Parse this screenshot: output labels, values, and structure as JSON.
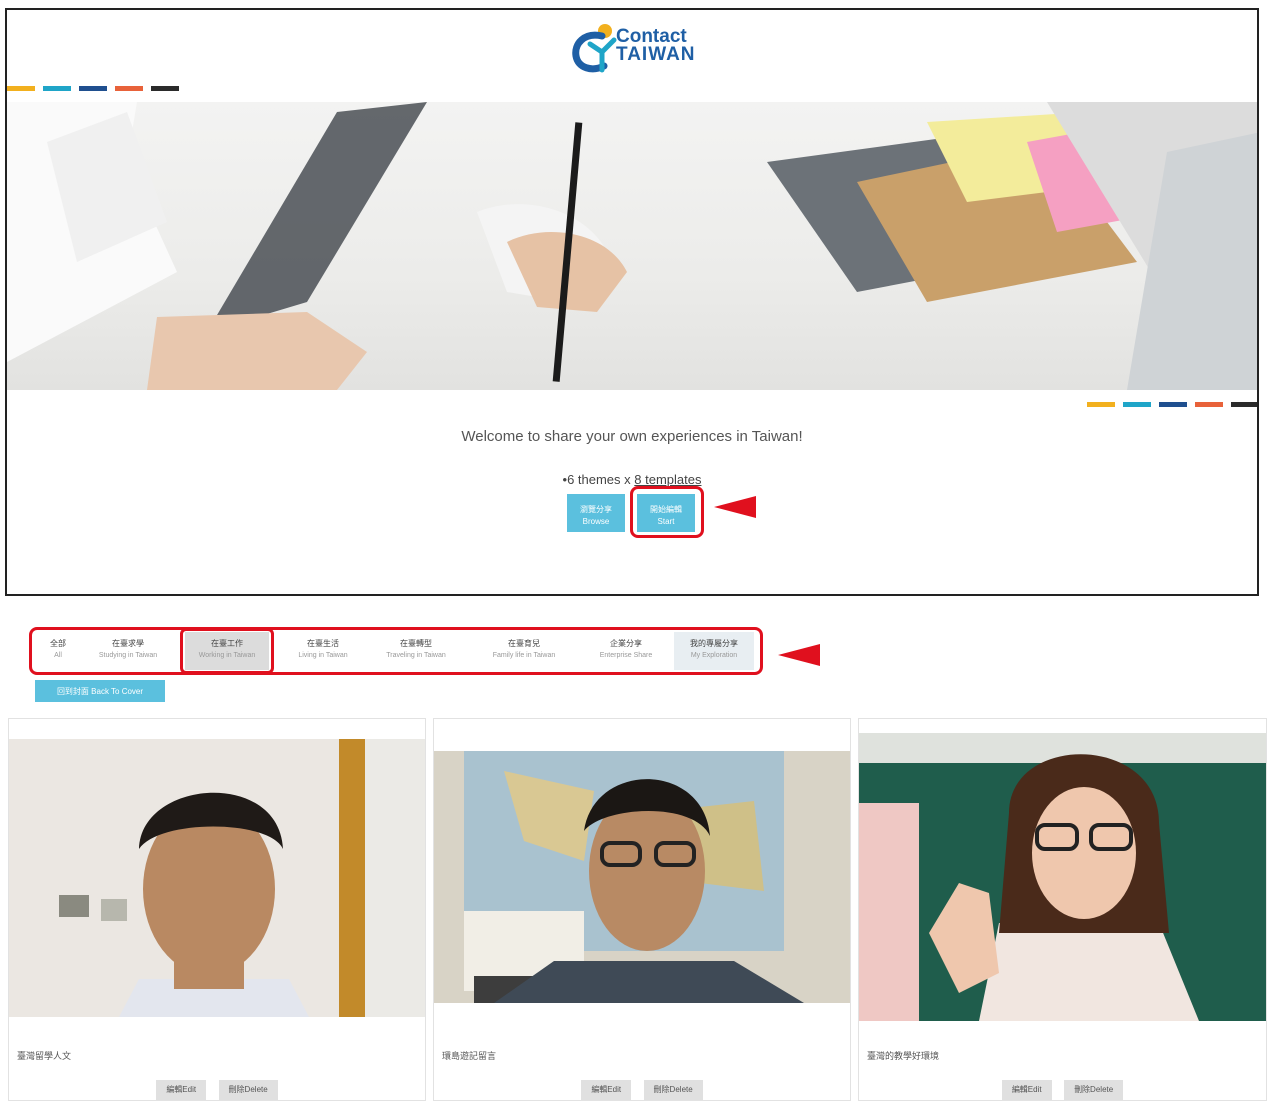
{
  "brand": {
    "logo_line1": "Contact",
    "logo_line2": "TAIWAN",
    "stripe_colors": [
      "#f2b01e",
      "#1fa5c8",
      "#1f4f8f",
      "#e8623a",
      "#2b2b2b"
    ]
  },
  "hero": {
    "welcome": "Welcome to share your own experiences in Taiwan!",
    "themes_prefix": "6 themes",
    "themes_joiner": " x ",
    "templates_link": "8 templates",
    "browse_zh": "瀏覽分享",
    "browse_en": "Browse",
    "start_zh": "開始編輯",
    "start_en": "Start"
  },
  "tabs": [
    {
      "zh": "全部",
      "en": "All"
    },
    {
      "zh": "在臺求學",
      "en": "Studying in Taiwan"
    },
    {
      "zh": "在臺工作",
      "en": "Working in Taiwan"
    },
    {
      "zh": "在臺生活",
      "en": "Living in Taiwan"
    },
    {
      "zh": "在臺轉型",
      "en": "Traveling in Taiwan"
    },
    {
      "zh": "在臺育兒",
      "en": "Family life in Taiwan"
    },
    {
      "zh": "企業分享",
      "en": "Enterprise Share"
    },
    {
      "zh": "我的專屬分享",
      "en": "My Exploration"
    }
  ],
  "back_button": "回到封面 Back To Cover",
  "cards": [
    {
      "title": "臺灣留學人文",
      "edit": "編輯Edit",
      "delete": "刪除Delete"
    },
    {
      "title": "環島遊記留言",
      "edit": "編輯Edit",
      "delete": "刪除Delete"
    },
    {
      "title": "臺灣的教學好環境",
      "edit": "編輯Edit",
      "delete": "刪除Delete"
    }
  ]
}
